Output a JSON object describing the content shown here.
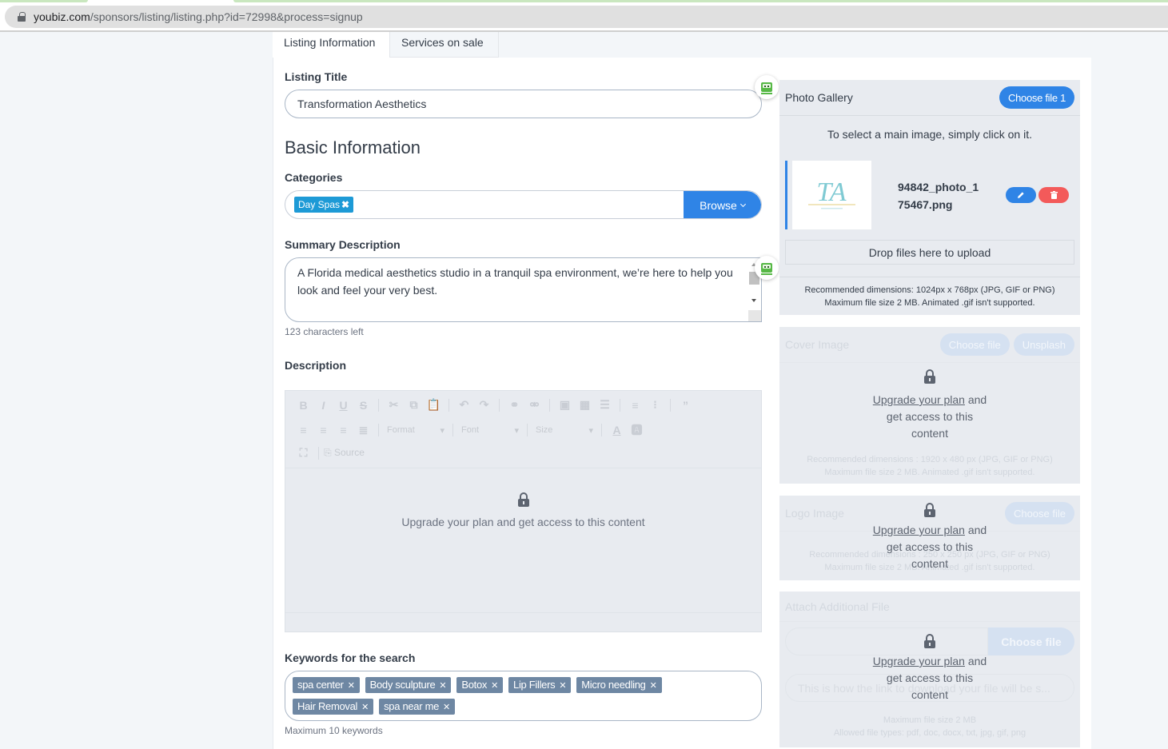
{
  "browser": {
    "url_host": "youbiz.com",
    "url_path": "/sponsors/listing/listing.php?id=72998&process=signup"
  },
  "tabs": [
    {
      "label": "Listing Information",
      "active": true
    },
    {
      "label": "Services on sale",
      "active": false
    }
  ],
  "listing_title": {
    "label": "Listing Title",
    "value": "Transformation Aesthetics"
  },
  "basic_info": {
    "heading": "Basic Information",
    "categories": {
      "label": "Categories",
      "selected": [
        "Day Spas"
      ],
      "browse_label": "Browse"
    },
    "summary": {
      "label": "Summary Description",
      "value": "A Florida medical aesthetics studio in a tranquil spa environment, we’re here to help you look and feel your very best.",
      "counter": "123 characters left"
    },
    "description": {
      "label": "Description",
      "toolbar": {
        "format_label": "Format",
        "font_label": "Font",
        "size_label": "Size",
        "source_label": "Source"
      },
      "locked_message": "Upgrade your plan and get access to this content"
    },
    "keywords": {
      "label": "Keywords for the search",
      "items": [
        "spa center",
        "Body sculpture",
        "Botox",
        "Lip Fillers",
        "Micro needling",
        "Hair Removal",
        "spa near me"
      ],
      "hint": "Maximum 10 keywords"
    }
  },
  "photo_gallery": {
    "title": "Photo Gallery",
    "choose_label": "Choose file 1",
    "hint": "To select a main image, simply click on it.",
    "file_name_line1": "94842_photo_1",
    "file_name_line2": "75467.png",
    "dropzone": "Drop files here to upload",
    "recommend_line1": "Recommended dimensions: 1024px x 768px (JPG, GIF or PNG)",
    "recommend_line2": "Maximum file size 2 MB. Animated .gif isn't supported."
  },
  "cover_image": {
    "title": "Cover Image",
    "choose_label": "Choose file",
    "unsplash_label": "Unsplash",
    "recommend_line1": "Recommended dimensions : 1920 x 480 px (JPG, GIF or PNG)",
    "recommend_line2": "Maximum file size 2 MB. Animated .gif isn't supported."
  },
  "logo_image": {
    "title": "Logo Image",
    "choose_label": "Choose file",
    "recommend_line1": "Recommended dimensions : 250 x 250 px (JPG, GIF or PNG)",
    "recommend_line2": "Maximum file size 2 MB. Animated .gif isn't supported."
  },
  "attach_file": {
    "title": "Attach Additional File",
    "choose_label": "Choose file",
    "link_placeholder": "This is how the link to download your file will be s...",
    "max_size": "Maximum file size 2 MB",
    "allowed_types": "Allowed file types: pdf, doc, docx, txt, jpg, gif, png"
  },
  "upgrade": {
    "link": "Upgrade your plan",
    "rest_line1": " and",
    "rest_line2": "get access to this",
    "rest_line3": "content"
  },
  "colors": {
    "accent": "#2f84e6",
    "danger": "#f35a5a",
    "chip": "#1d9ad6",
    "keyword_chip": "#6e87a3"
  }
}
